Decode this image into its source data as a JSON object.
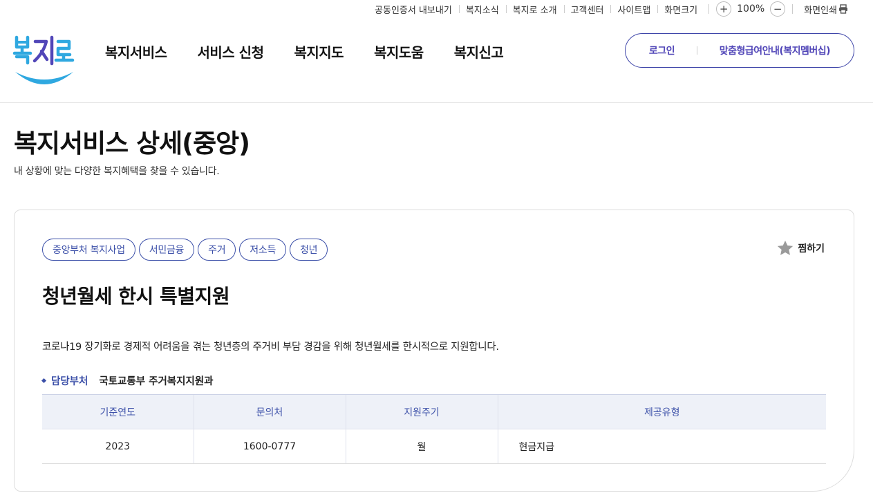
{
  "utility": {
    "links": [
      "공동인증서 내보내기",
      "복지소식",
      "복지로 소개",
      "고객센터",
      "사이트맵"
    ],
    "zoom_label": "화면크기",
    "zoom_in": "+",
    "zoom_value": "100%",
    "zoom_out": "−",
    "print_label": "화면인쇄"
  },
  "header": {
    "logo_text": "복지로",
    "nav": [
      "복지서비스",
      "서비스 신청",
      "복지지도",
      "복지도움",
      "복지신고"
    ],
    "login": "로그인",
    "membership": "맞춤형급여안내(복지멤버십)"
  },
  "page": {
    "title": "복지서비스 상세(중앙)",
    "description": "내 상황에 맞는 다양한 복지혜택을 찾을 수 있습니다."
  },
  "service": {
    "tags": [
      "중앙부처 복지사업",
      "서민금융",
      "주거",
      "저소득",
      "청년"
    ],
    "favorite_label": "찜하기",
    "title": "청년월세 한시 특별지원",
    "description": "코로나19 장기화로 경제적 어려움을 겪는 청년층의 주거비 부담 경감을 위해 청년월세를 한시적으로 지원합니다.",
    "department_label": "담당부처",
    "department": "국토교통부 주거복지지원과",
    "table": {
      "headers": [
        "기준연도",
        "문의처",
        "지원주기",
        "제공유형"
      ],
      "row": [
        "2023",
        "1600-0777",
        "월",
        "현금지급"
      ]
    }
  },
  "colors": {
    "accent": "#3b4fa8",
    "logo_blue": "#2fa8e0",
    "logo_purple": "#5146b8",
    "table_header_bg": "#eef1f8"
  }
}
